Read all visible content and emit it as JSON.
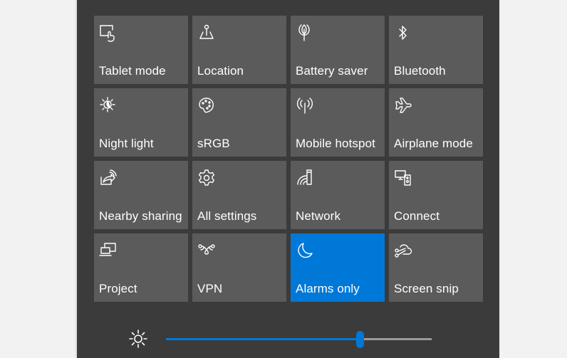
{
  "colors": {
    "panel": "#3b3b3b",
    "tile": "#5b5b5b",
    "accent": "#0078d7",
    "background": "#f2f2f2"
  },
  "tiles": [
    {
      "label": "Tablet mode",
      "icon": "tablet-mode-icon",
      "active": false
    },
    {
      "label": "Location",
      "icon": "location-icon",
      "active": false
    },
    {
      "label": "Battery saver",
      "icon": "battery-saver-icon",
      "active": false
    },
    {
      "label": "Bluetooth",
      "icon": "bluetooth-icon",
      "active": false
    },
    {
      "label": "Night light",
      "icon": "night-light-icon",
      "active": false
    },
    {
      "label": "sRGB",
      "icon": "palette-icon",
      "active": false
    },
    {
      "label": "Mobile hotspot",
      "icon": "mobile-hotspot-icon",
      "active": false
    },
    {
      "label": "Airplane mode",
      "icon": "airplane-icon",
      "active": false
    },
    {
      "label": "Nearby sharing",
      "icon": "nearby-sharing-icon",
      "active": false
    },
    {
      "label": "All settings",
      "icon": "gear-icon",
      "active": false
    },
    {
      "label": "Network",
      "icon": "network-icon",
      "active": false
    },
    {
      "label": "Connect",
      "icon": "connect-icon",
      "active": false
    },
    {
      "label": "Project",
      "icon": "project-icon",
      "active": false
    },
    {
      "label": "VPN",
      "icon": "vpn-icon",
      "active": false
    },
    {
      "label": "Alarms only",
      "icon": "moon-icon",
      "active": true
    },
    {
      "label": "Screen snip",
      "icon": "screen-snip-icon",
      "active": false
    }
  ],
  "brightness": {
    "icon": "sun-icon",
    "value_percent": 73
  }
}
